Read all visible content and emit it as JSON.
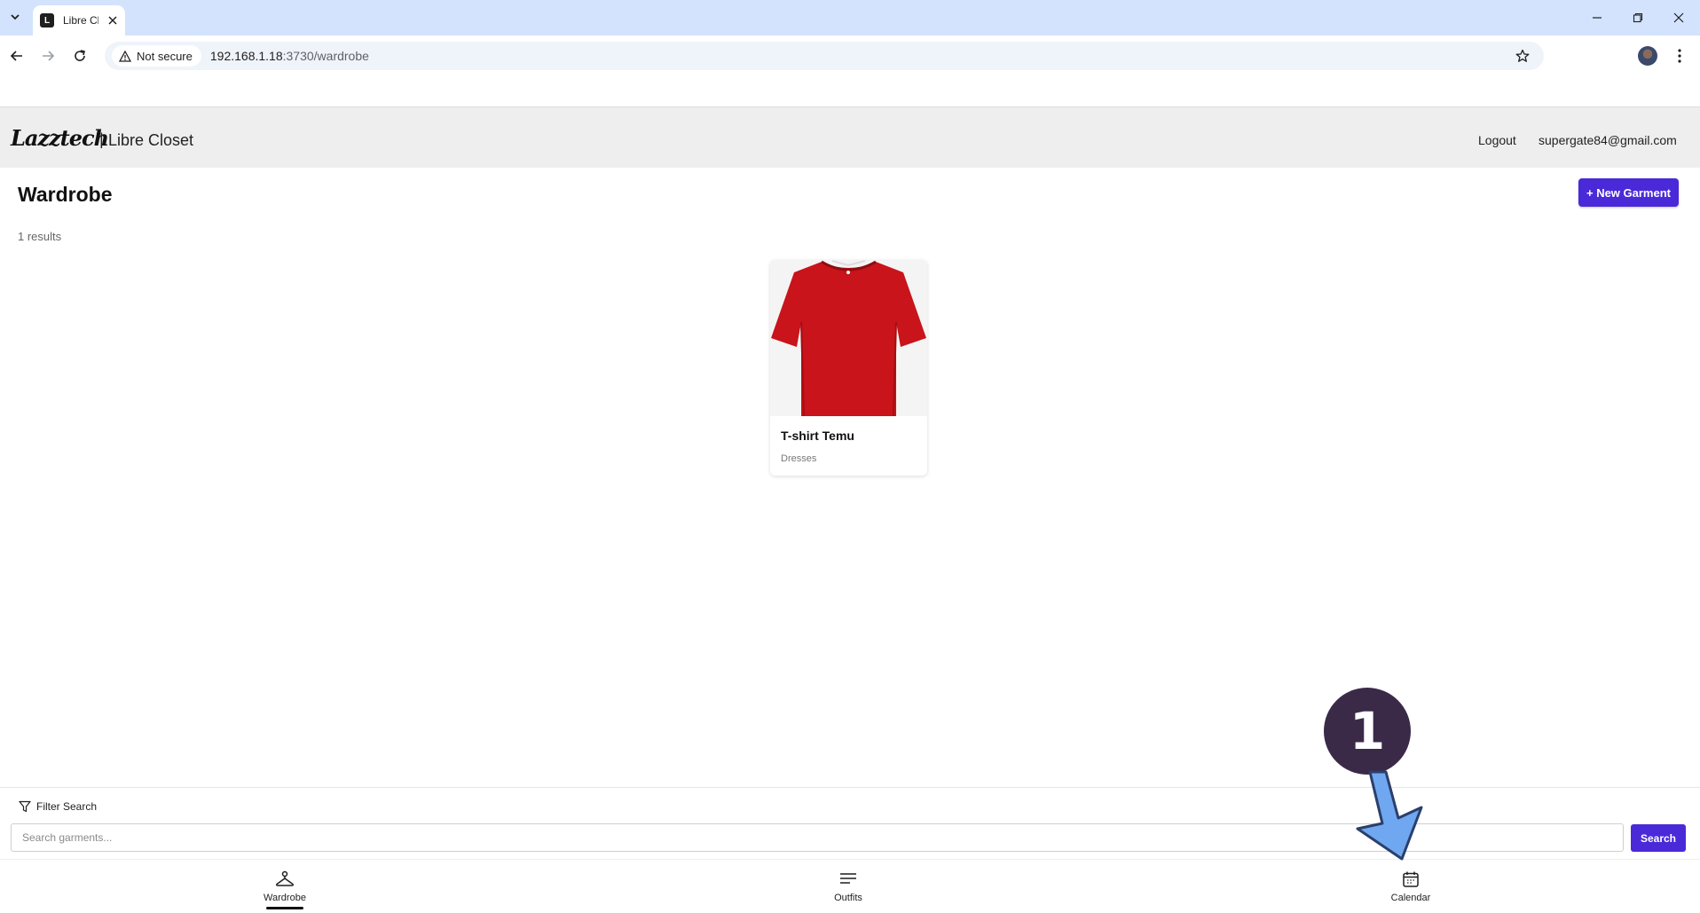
{
  "browser": {
    "tab_title": "Libre Closet",
    "security_label": "Not secure",
    "url_host": "192.168.1.18",
    "url_path": ":3730/wardrobe"
  },
  "header": {
    "logo_text": "Lazztech",
    "separator": "|",
    "app_name": "Libre Closet",
    "logout_label": "Logout",
    "user_email": "supergate84@gmail.com"
  },
  "page": {
    "title": "Wardrobe",
    "new_button_label": "+ New Garment",
    "results_text": "1 results"
  },
  "garments": [
    {
      "name": "T-shirt Temu",
      "category": "Dresses",
      "image": "red-tshirt"
    }
  ],
  "search": {
    "filter_label": "Filter Search",
    "placeholder": "Search garments...",
    "value": "",
    "button_label": "Search"
  },
  "bottom_nav": {
    "items": [
      {
        "label": "Wardrobe",
        "icon": "hanger-icon",
        "active": true
      },
      {
        "label": "Outfits",
        "icon": "lines-icon",
        "active": false
      },
      {
        "label": "Calendar",
        "icon": "calendar-icon",
        "active": false
      }
    ]
  },
  "annotation": {
    "step_number": "1",
    "badge_color": "#3a2a48",
    "arrow_color": "#6fa8f0"
  },
  "colors": {
    "accent": "#4a2ad8",
    "header_bg": "#eeeeee",
    "tabstrip_bg": "#d3e3fd"
  }
}
